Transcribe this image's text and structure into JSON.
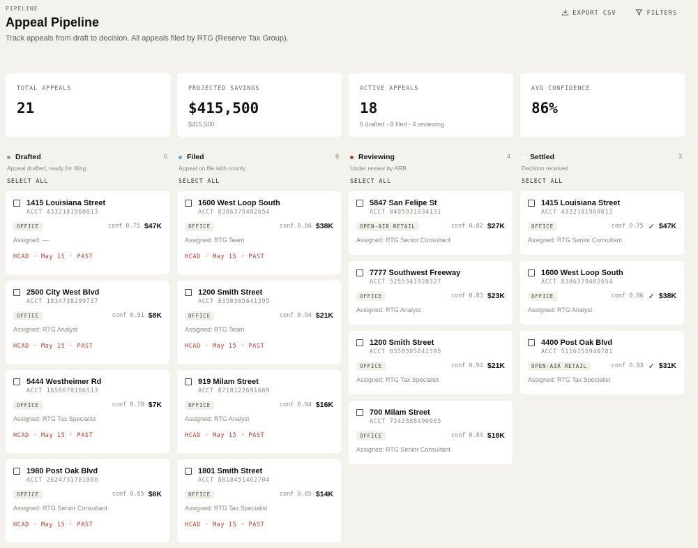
{
  "header": {
    "eyebrow": "PIPELINE",
    "title": "Appeal Pipeline",
    "subtitle": "Track appeals from draft to decision. All appeals filed by RTG (Reserve Tax Group).",
    "export_label": "EXPORT CSV",
    "filters_label": "FILTERS",
    "export_icon": "download-icon",
    "filters_icon": "filter-icon"
  },
  "stats": [
    {
      "label": "TOTAL APPEALS",
      "value": "21",
      "sub": ""
    },
    {
      "label": "PROJECTED SAVINGS",
      "value": "$415,500",
      "sub": "$415,500"
    },
    {
      "label": "ACTIVE APPEALS",
      "value": "18",
      "sub": "6 drafted · 8 filed · 4 reviewing"
    },
    {
      "label": "AVG CONFIDENCE",
      "value": "86%",
      "sub": ""
    }
  ],
  "colors": {
    "drafted": "#9a9a94",
    "filed": "#5aa0e6",
    "reviewing": "#a9471f",
    "settled": "#ffffff",
    "hcad": "#c0392b"
  },
  "columns": [
    {
      "title": "Drafted",
      "count": "6",
      "desc": "Appeal drafted, ready for filing",
      "select_all": "SELECT ALL",
      "cards": [
        {
          "address": "1415 Louisiana Street",
          "acct": "ACCT 4332181960013",
          "tag": "OFFICE",
          "conf": "conf 0.75",
          "amount": "$47K",
          "assigned": "Assigned: —",
          "hcad": "HCAD · May 15 · PAST"
        },
        {
          "address": "2500 City West Blvd",
          "acct": "ACCT 1834738299737",
          "tag": "OFFICE",
          "conf": "conf 0.91",
          "amount": "$8K",
          "assigned": "Assigned: RTG Analyst",
          "hcad": "HCAD · May 15 · PAST"
        },
        {
          "address": "5444 Westheimer Rd",
          "acct": "ACCT 1656670106513",
          "tag": "OFFICE",
          "conf": "conf 0.78",
          "amount": "$7K",
          "assigned": "Assigned: RTG Tax Specialist",
          "hcad": "HCAD · May 15 · PAST"
        },
        {
          "address": "1980 Post Oak Blvd",
          "acct": "ACCT 2624731781080",
          "tag": "OFFICE",
          "conf": "conf 0.85",
          "amount": "$6K",
          "assigned": "Assigned: RTG Senior Consultant",
          "hcad": "HCAD · May 15 · PAST"
        }
      ]
    },
    {
      "title": "Filed",
      "count": "8",
      "desc": "Appeal on file with county",
      "select_all": "SELECT ALL",
      "cards": [
        {
          "address": "1600 West Loop South",
          "acct": "ACCT 8386379402654",
          "tag": "OFFICE",
          "conf": "conf 0.86",
          "amount": "$38K",
          "assigned": "Assigned: RTG Team",
          "hcad": "HCAD · May 15 · PAST"
        },
        {
          "address": "1200 Smith Street",
          "acct": "ACCT 8350305641395",
          "tag": "OFFICE",
          "conf": "conf 0.94",
          "amount": "$21K",
          "assigned": "Assigned: RTG Team",
          "hcad": "HCAD · May 15 · PAST"
        },
        {
          "address": "919 Milam Street",
          "acct": "ACCT 8710122691669",
          "tag": "OFFICE",
          "conf": "conf 0.94",
          "amount": "$16K",
          "assigned": "Assigned: RTG Analyst",
          "hcad": "HCAD · May 15 · PAST"
        },
        {
          "address": "1801 Smith Street",
          "acct": "ACCT 8018451462704",
          "tag": "OFFICE",
          "conf": "conf 0.85",
          "amount": "$14K",
          "assigned": "Assigned: RTG Tax Specialist",
          "hcad": "HCAD · May 15 · PAST"
        }
      ]
    },
    {
      "title": "Reviewing",
      "count": "4",
      "desc": "Under review by ARB",
      "select_all": "SELECT ALL",
      "cards": [
        {
          "address": "5847 San Felipe St",
          "acct": "ACCT 8495931034131",
          "tag": "OPEN-AIR RETAIL",
          "conf": "conf 0.82",
          "amount": "$27K",
          "assigned": "Assigned: RTG Senior Consultant"
        },
        {
          "address": "7777 Southwest Freeway",
          "acct": "ACCT 5255341928327",
          "tag": "OFFICE",
          "conf": "conf 0.83",
          "amount": "$23K",
          "assigned": "Assigned: RTG Analyst"
        },
        {
          "address": "1200 Smith Street",
          "acct": "ACCT 8350305641395",
          "tag": "OFFICE",
          "conf": "conf 0.94",
          "amount": "$21K",
          "assigned": "Assigned: RTG Tax Specialist"
        },
        {
          "address": "700 Milam Street",
          "acct": "ACCT 7242388496965",
          "tag": "OFFICE",
          "conf": "conf 0.84",
          "amount": "$18K",
          "assigned": "Assigned: RTG Senior Consultant"
        }
      ]
    },
    {
      "title": "Settled",
      "count": "3",
      "desc": "Decision received",
      "select_all": "SELECT ALL",
      "cards": [
        {
          "address": "1415 Louisiana Street",
          "acct": "ACCT 4332181960013",
          "tag": "OFFICE",
          "conf": "conf 0.75",
          "check": "✓",
          "amount": "$47K",
          "assigned": "Assigned: RTG Senior Consultant"
        },
        {
          "address": "1600 West Loop South",
          "acct": "ACCT 8386379402654",
          "tag": "OFFICE",
          "conf": "conf 0.86",
          "check": "✓",
          "amount": "$38K",
          "assigned": "Assigned: RTG Analyst"
        },
        {
          "address": "4400 Post Oak Blvd",
          "acct": "ACCT 5116155940781",
          "tag": "OPEN-AIR RETAIL",
          "conf": "conf 0.93",
          "check": "✓",
          "amount": "$31K",
          "assigned": "Assigned: RTG Tax Specialist"
        }
      ]
    }
  ]
}
